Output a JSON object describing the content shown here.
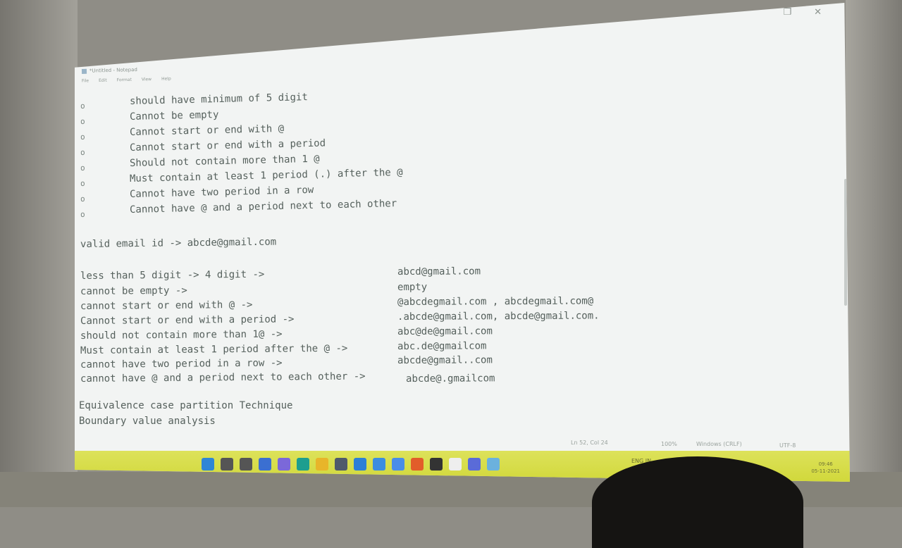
{
  "window": {
    "title": "*Untitled - Notepad",
    "menu": [
      "File",
      "Edit",
      "Format",
      "View",
      "Help"
    ],
    "controls": [
      "restore",
      "close"
    ]
  },
  "editor": {
    "bullet_symbol": "o",
    "bullets": [
      "should have minimum of 5 digit",
      "Cannot be empty",
      "Cannot start or end with @",
      "Cannot start or end with a period",
      "Should not contain more than 1 @",
      "Must contain at least 1 period (.) after the @",
      "Cannot have two period in a row",
      "Cannot have @ and a period next to each other"
    ],
    "valid_line": "valid email id -> abcde@gmail.com",
    "cases": [
      {
        "label": "less than 5 digit -> 4 digit ->",
        "example": "abcd@gmail.com"
      },
      {
        "label": "cannot be empty ->",
        "example": "empty"
      },
      {
        "label": "cannot start or end with @ ->",
        "example": "@abcdegmail.com , abcdegmail.com@"
      },
      {
        "label": "Cannot start or end with a period ->",
        "example": ".abcde@gmail.com, abcde@gmail.com."
      },
      {
        "label": "should not contain more than 1@ ->",
        "example": "abc@de@gmail.com"
      },
      {
        "label": "Must contain at least 1 period after the @ ->",
        "example": "abc.de@gmailcom"
      },
      {
        "label": "cannot have two period in a row ->",
        "example": "abcde@gmail..com"
      },
      {
        "label": "cannot have @ and a period next to each other ->",
        "example": "abcde@.gmailcom"
      }
    ],
    "technique_lines": [
      "Equivalence case partition Technique",
      "Boundary value analysis"
    ]
  },
  "statusbar": {
    "position": "Ln 52, Col 24",
    "zoom": "100%",
    "line_ending": "Windows (CRLF)",
    "encoding": "UTF-8"
  },
  "taskbar": {
    "icons": [
      {
        "name": "windows-start-icon",
        "color": "#2f86d6"
      },
      {
        "name": "search-icon",
        "color": "#555555"
      },
      {
        "name": "task-view-icon",
        "color": "#555555"
      },
      {
        "name": "widgets-icon",
        "color": "#3b6fd1"
      },
      {
        "name": "chat-icon",
        "color": "#7b68d9"
      },
      {
        "name": "edge-icon",
        "color": "#1e9e8f"
      },
      {
        "name": "file-explorer-icon",
        "color": "#e8b52a"
      },
      {
        "name": "store-icon",
        "color": "#4f5a6b"
      },
      {
        "name": "mail-icon",
        "color": "#2d7fd6"
      },
      {
        "name": "calendar-icon",
        "color": "#3c8de0"
      },
      {
        "name": "app-icon",
        "color": "#4a8de8"
      },
      {
        "name": "office-icon",
        "color": "#e25d2a"
      },
      {
        "name": "media-icon",
        "color": "#333333"
      },
      {
        "name": "notepad-icon",
        "color": "#eeeeee"
      },
      {
        "name": "teams-icon",
        "color": "#5a6bd8"
      },
      {
        "name": "notepad-active-icon",
        "color": "#6bb1de"
      }
    ],
    "tray_text": "ENG IN",
    "time": "09:46",
    "date": "05-11-2021"
  }
}
